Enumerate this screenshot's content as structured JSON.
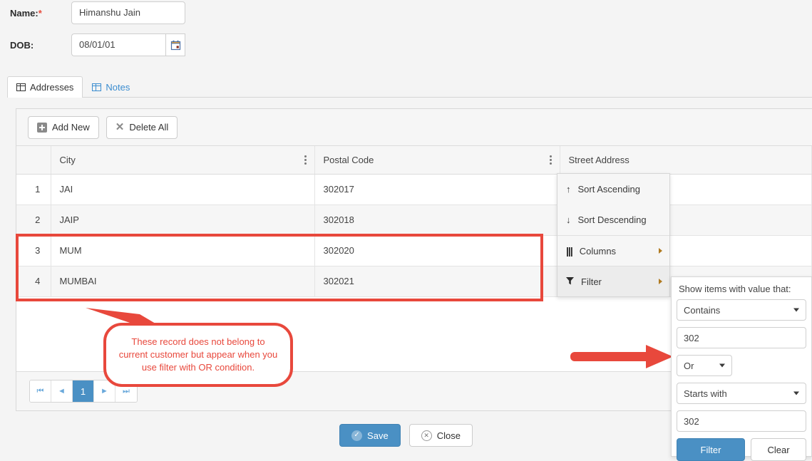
{
  "form": {
    "name": {
      "label": "Name:",
      "required_mark": "*",
      "value": "Himanshu Jain"
    },
    "dob": {
      "label": "DOB:",
      "value": "08/01/01",
      "picker_icon": "calendar-icon"
    }
  },
  "tabs": [
    {
      "label": "Addresses",
      "icon": "grid-icon",
      "active": true
    },
    {
      "label": "Notes",
      "icon": "grid-icon",
      "active": false
    }
  ],
  "toolbar": {
    "add_new_label": "Add New",
    "add_new_icon": "plus-square-icon",
    "delete_all_label": "Delete All",
    "delete_all_icon": "close-x-icon"
  },
  "grid": {
    "columns": [
      "",
      "City",
      "Postal Code",
      "Street Address"
    ],
    "rows": [
      {
        "num": "1",
        "city": "JAI",
        "postal": "302017",
        "street": ""
      },
      {
        "num": "2",
        "city": "JAIP",
        "postal": "302018",
        "street": ""
      },
      {
        "num": "3",
        "city": "MUM",
        "postal": "302020",
        "street": ""
      },
      {
        "num": "4",
        "city": "MUMBAI",
        "postal": "302021",
        "street": ""
      }
    ]
  },
  "pager": {
    "first": "⏮",
    "prev": "◄",
    "current_page": "1",
    "next": "►",
    "last": "⏭"
  },
  "column_menu": {
    "items": [
      {
        "label": "Sort Ascending",
        "icon": "arrow-up-icon",
        "has_submenu": false
      },
      {
        "label": "Sort Descending",
        "icon": "arrow-down-icon",
        "has_submenu": false
      },
      {
        "label": "Columns",
        "icon": "columns-icon",
        "has_submenu": true
      },
      {
        "label": "Filter",
        "icon": "funnel-icon",
        "has_submenu": true,
        "highlighted": true
      }
    ]
  },
  "filter_panel": {
    "title": "Show items with value that:",
    "operator1": "Contains",
    "value1": "302",
    "logic": "Or",
    "operator2": "Starts with",
    "value2": "302",
    "filter_button": "Filter",
    "clear_button": "Clear"
  },
  "footer": {
    "save_label": "Save",
    "save_icon": "check-circle-icon",
    "close_label": "Close",
    "close_icon": "close-circle-icon"
  },
  "annotations": {
    "callout_text": "These record does not belong to current customer but appear when you use filter with OR condition.",
    "highlight_color": "#e8483c",
    "arrow_icon": "arrow-right-icon"
  },
  "colors": {
    "accent_blue": "#4a90c4",
    "annotation_red": "#e8483c",
    "page_background": "#f4f4f4"
  }
}
